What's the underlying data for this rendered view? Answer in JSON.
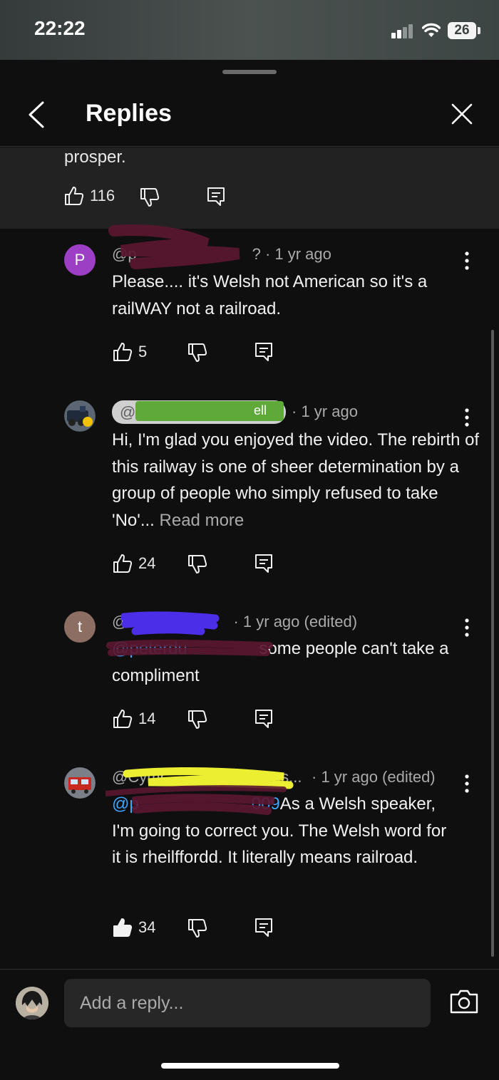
{
  "status_bar": {
    "time": "22:22",
    "battery": "26"
  },
  "header": {
    "title": "Replies"
  },
  "parent_comment": {
    "text": "prosper.",
    "likes": "116"
  },
  "replies": [
    {
      "avatar_letter": "P",
      "avatar_color": "#9c3fc4",
      "handle": "@p",
      "handle_tail": "?",
      "time": "· 1 yr ago",
      "body": "Please.... it's Welsh not American so it's a railWAY not a railroad.",
      "likes": "5"
    },
    {
      "handle": "@",
      "handle_tail": "ell",
      "time": "· 1 yr ago",
      "body": "Hi, I'm glad you enjoyed the video. The rebirth of this railway is one of sheer determination by a group of people who simply refused to take 'No'...",
      "read_more": "Read more",
      "likes": "24"
    },
    {
      "avatar_letter": "t",
      "avatar_color": "#8d6e63",
      "handle": "@",
      "time": "· 1 yr ago (edited)",
      "mention": "@peterdu",
      "body": "some people can't take a compliment",
      "likes": "14"
    },
    {
      "handle": "@Cymr",
      "handle_tail": "Res...",
      "time": "· 1 yr ago (edited)",
      "mention": "@p",
      "mention_tail": "009",
      "body": "As a Welsh speaker, I'm going to correct you. The Welsh word for it is rheilffordd. It literally means railroad.",
      "likes": "34"
    }
  ],
  "footer": {
    "reply_placeholder": "Add a reply..."
  },
  "colors": {
    "background": "#0f0f0f",
    "parent_bg": "#222222",
    "link": "#3ea6ff",
    "secondary_text": "#aaaaaa"
  }
}
